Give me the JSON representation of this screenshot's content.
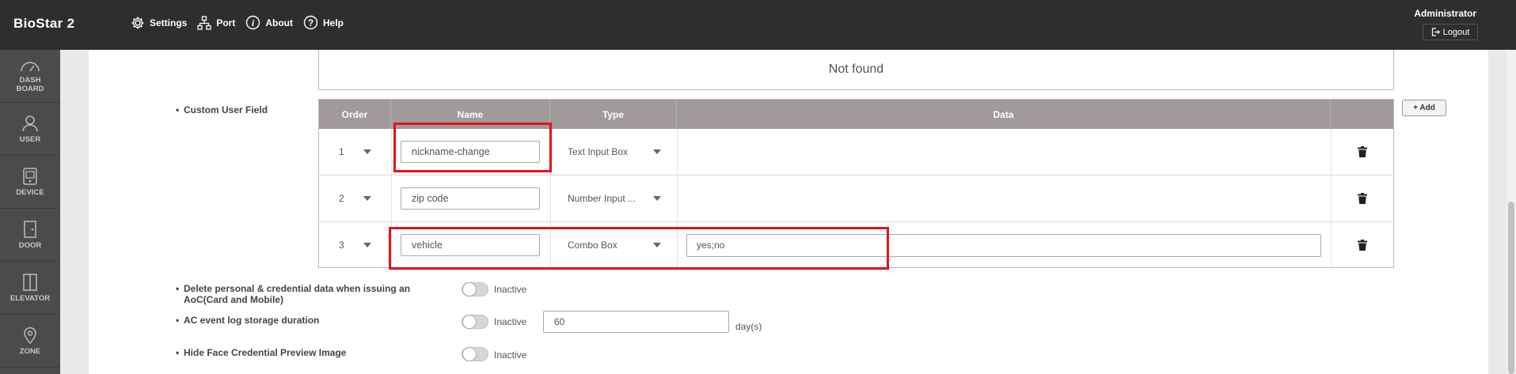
{
  "app": {
    "name": "BioStar 2"
  },
  "topnav": [
    {
      "label": "Settings",
      "icon": "gear-icon"
    },
    {
      "label": "Port",
      "icon": "network-icon"
    },
    {
      "label": "About",
      "icon": "info-icon"
    },
    {
      "label": "Help",
      "icon": "help-icon"
    }
  ],
  "user": {
    "name": "Administrator",
    "logout_label": "Logout"
  },
  "sidebar": {
    "items": [
      {
        "line1": "DASH",
        "line2": "BOARD",
        "icon": "gauge-icon"
      },
      {
        "line1": "USER",
        "line2": "",
        "icon": "user-icon"
      },
      {
        "line1": "DEVICE",
        "line2": "",
        "icon": "device-icon"
      },
      {
        "line1": "DOOR",
        "line2": "",
        "icon": "door-icon"
      },
      {
        "line1": "ELEVATOR",
        "line2": "",
        "icon": "elevator-icon"
      },
      {
        "line1": "ZONE",
        "line2": "",
        "icon": "zone-pin-icon"
      }
    ]
  },
  "not_found_text": "Not found",
  "custom_user_field": {
    "label": "Custom User Field",
    "add_label": "+ Add",
    "headers": {
      "order": "Order",
      "name": "Name",
      "type": "Type",
      "data": "Data"
    },
    "rows": [
      {
        "order": "1",
        "name": "nickname-change",
        "type": "Text Input Box",
        "data": ""
      },
      {
        "order": "2",
        "name": "zip code",
        "type": "Number Input ...",
        "data": ""
      },
      {
        "order": "3",
        "name": "vehicle",
        "type": "Combo Box",
        "data": "yes;no"
      }
    ]
  },
  "settings": {
    "delete_data": {
      "label_line1": "Delete personal & credential data when issuing an",
      "label_line2": "AoC(Card and Mobile)",
      "state": "Inactive"
    },
    "ac_log": {
      "label": "AC event log storage duration",
      "state": "Inactive",
      "value": "60",
      "unit": "day(s)"
    },
    "hide_face": {
      "label": "Hide Face Credential Preview Image",
      "state": "Inactive"
    }
  },
  "colors": {
    "topbar": "#2e2e2e",
    "sidebar": "#4b4b4b",
    "table_header": "#a29a9a",
    "highlight": "#e2131c"
  }
}
